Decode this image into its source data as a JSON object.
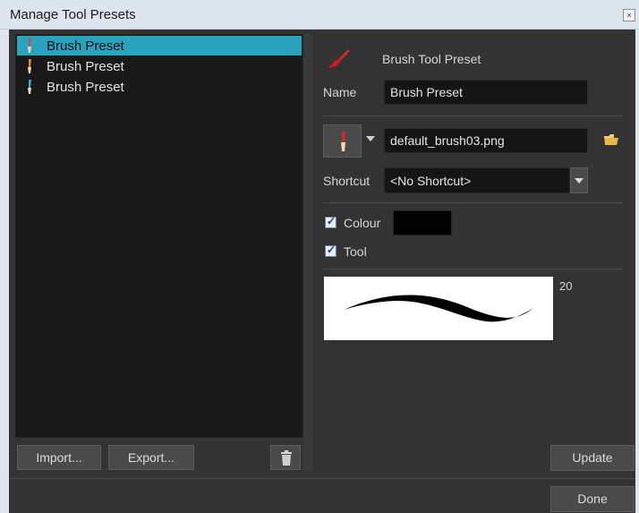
{
  "window": {
    "title": "Manage Tool Presets",
    "close_icon": "close-icon"
  },
  "presets": [
    {
      "label": "Brush Preset",
      "color": "#c84a5c",
      "selected": true
    },
    {
      "label": "Brush Preset",
      "color": "#e08a2a",
      "selected": false
    },
    {
      "label": "Brush Preset",
      "color": "#3aa7e0",
      "selected": false
    }
  ],
  "left_buttons": {
    "import": "Import...",
    "export": "Export..."
  },
  "details": {
    "tool_type": "Brush Tool Preset",
    "name_label": "Name",
    "name_value": "Brush Preset",
    "icon_file": "default_brush03.png",
    "shortcut_label": "Shortcut",
    "shortcut_value": "<No Shortcut>",
    "colour_label": "Colour",
    "colour_checked": true,
    "colour_swatch": "#000000",
    "tool_label": "Tool",
    "tool_checked": true,
    "size_value": "20"
  },
  "buttons": {
    "update": "Update",
    "done": "Done"
  },
  "colors": {
    "selection": "#2aa3bf",
    "panel": "#333333",
    "list_bg": "#191919"
  }
}
